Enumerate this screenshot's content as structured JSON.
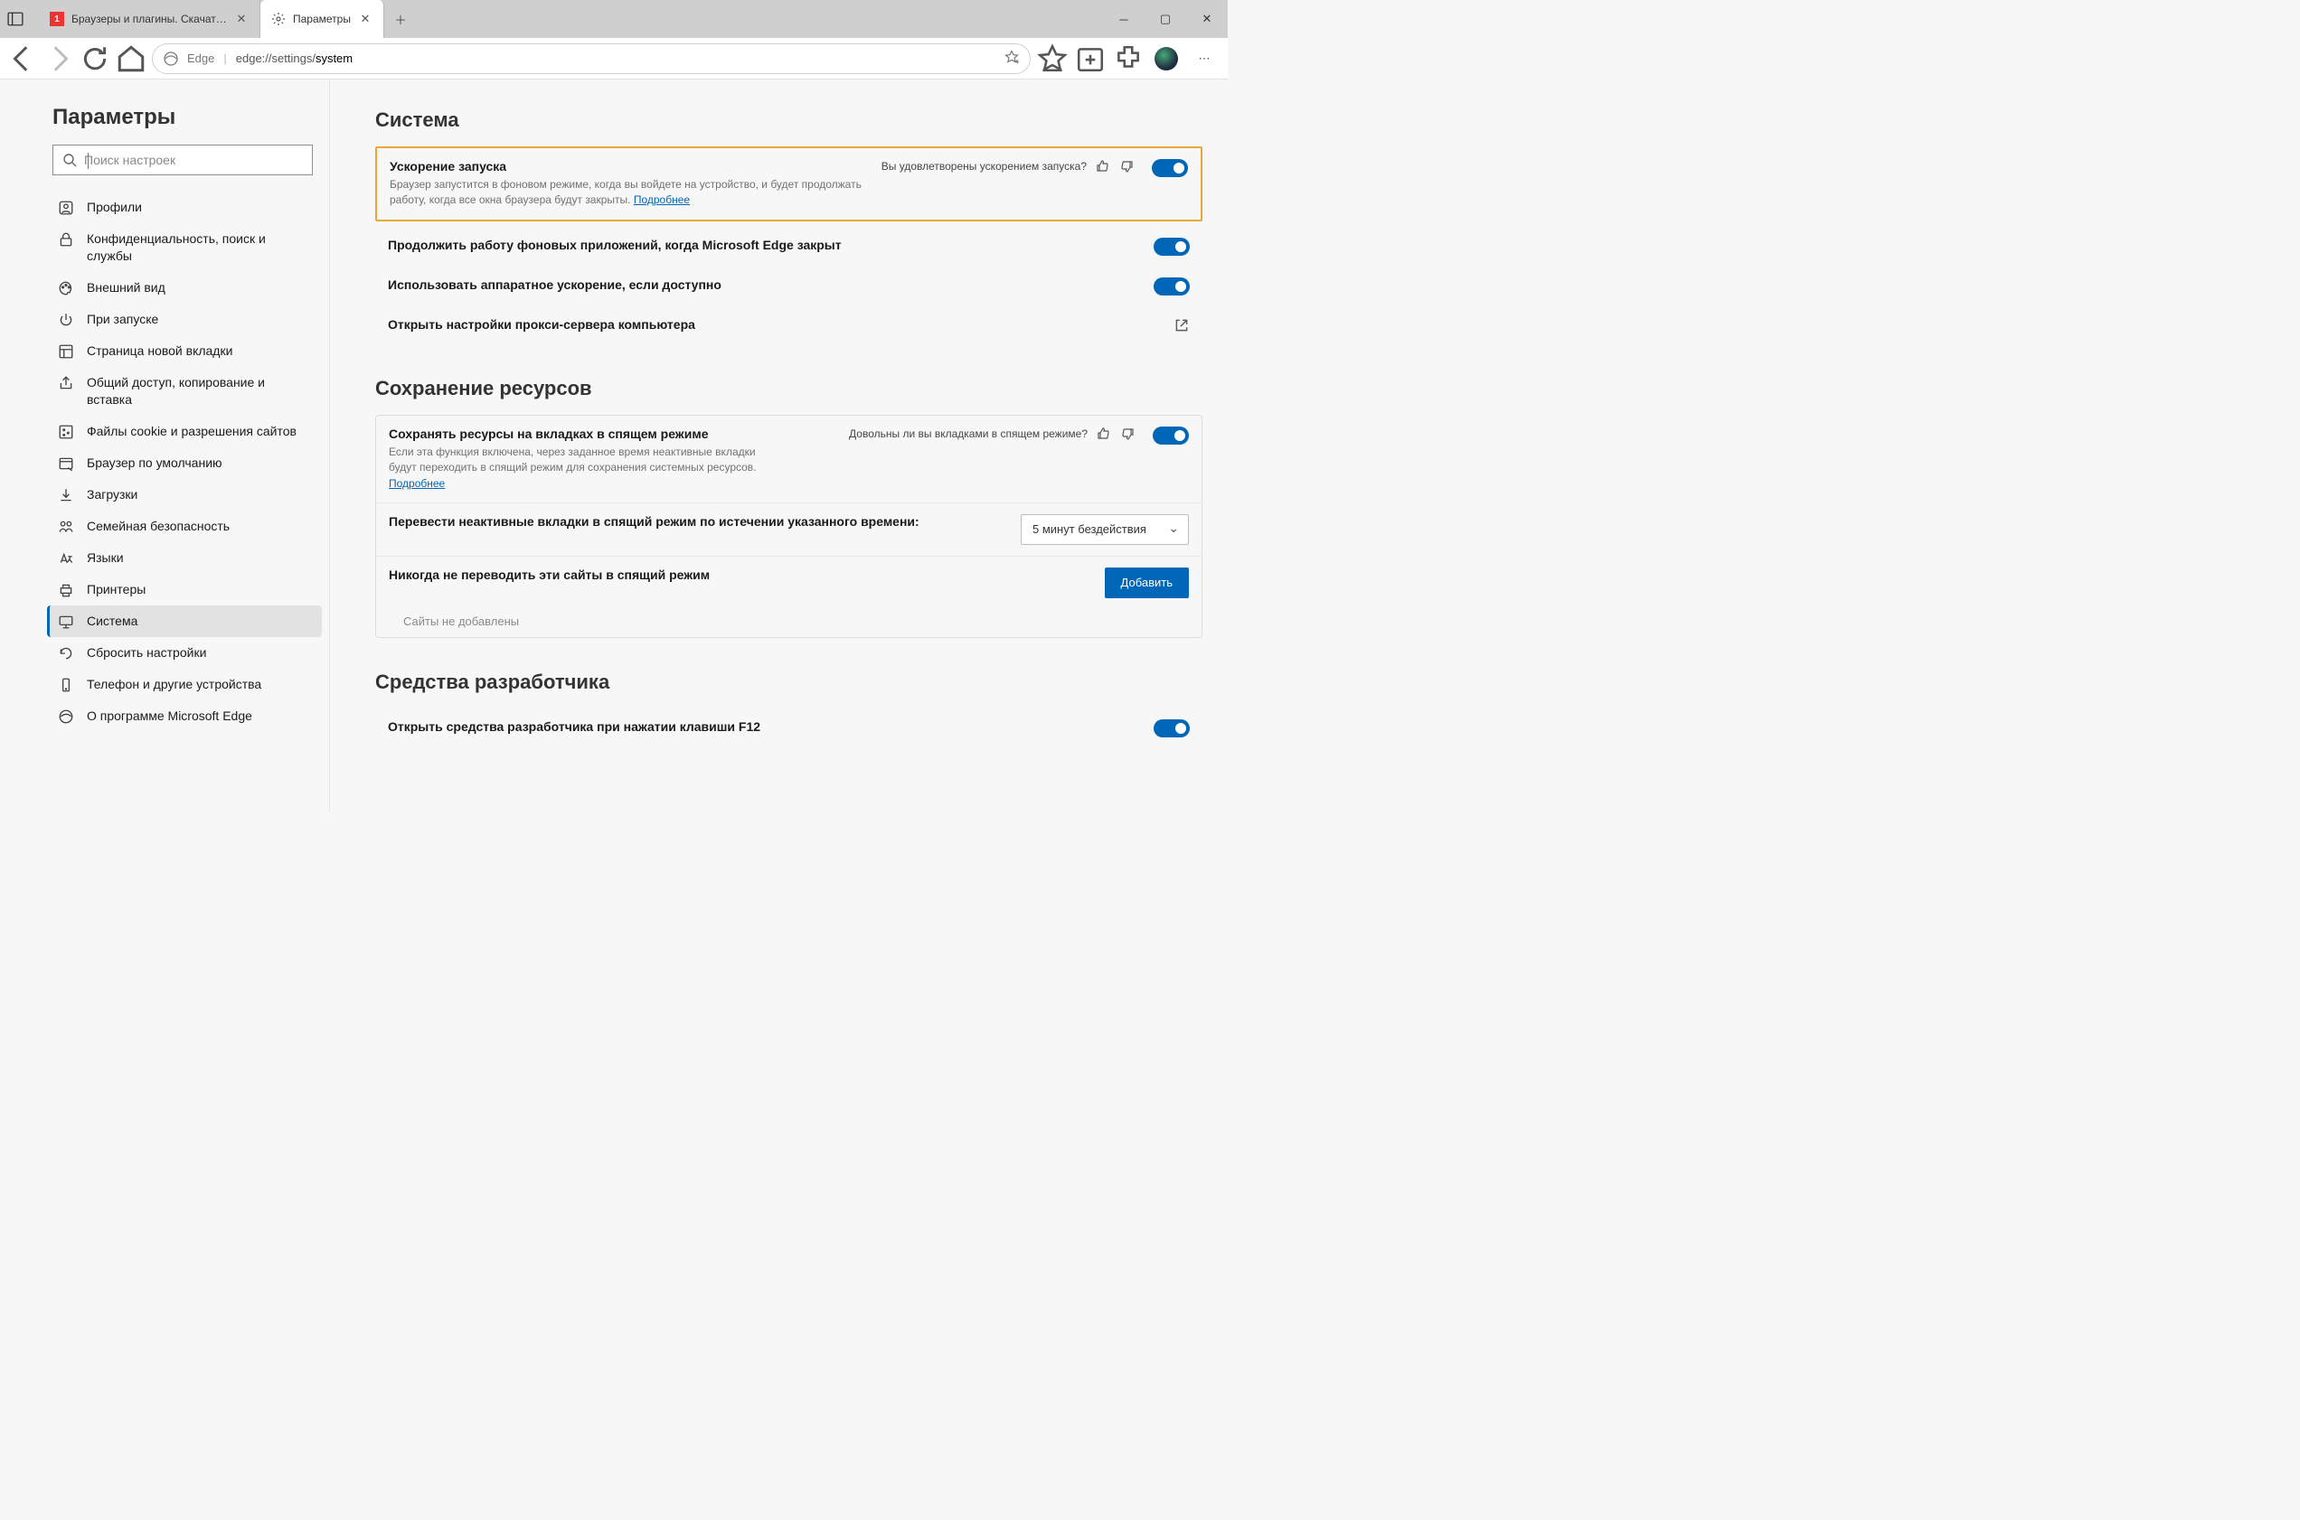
{
  "tabs": {
    "t0": {
      "title": "Браузеры и плагины. Скачать б"
    },
    "t1": {
      "title": "Параметры"
    }
  },
  "address": {
    "edge_label": "Edge",
    "url_prefix": "edge://settings/",
    "url_page": "system"
  },
  "sidebar": {
    "heading": "Параметры",
    "search_placeholder": "Поиск настроек",
    "items": {
      "profiles": "Профили",
      "privacy": "Конфиденциальность, поиск и службы",
      "appearance": "Внешний вид",
      "onstart": "При запуске",
      "newtab": "Страница новой вкладки",
      "share": "Общий доступ, копирование и вставка",
      "cookies": "Файлы cookie и разрешения сайтов",
      "default": "Браузер по умолчанию",
      "downloads": "Загрузки",
      "family": "Семейная безопасность",
      "languages": "Языки",
      "printers": "Принтеры",
      "system": "Система",
      "reset": "Сбросить настройки",
      "phone": "Телефон и другие устройства",
      "about": "О программе Microsoft Edge"
    }
  },
  "main": {
    "system_heading": "Система",
    "startup": {
      "title": "Ускорение запуска",
      "desc": "Браузер запустится в фоновом режиме, когда вы войдете на устройство, и будет продолжать работу, когда все окна браузера будут закрыты. ",
      "more": "Подробнее",
      "feedback": "Вы удовлетворены ускорением запуска?"
    },
    "bg_apps": "Продолжить работу фоновых приложений, когда Microsoft Edge закрыт",
    "hw_accel": "Использовать аппаратное ускорение, если доступно",
    "proxy": "Открыть настройки прокси-сервера компьютера",
    "resources_heading": "Сохранение ресурсов",
    "sleep": {
      "title": "Сохранять ресурсы на вкладках в спящем режиме",
      "desc": "Если эта функция включена, через заданное время неактивные вкладки будут переходить в спящий режим для сохранения системных ресурсов. ",
      "more": "Подробнее",
      "feedback": "Довольны ли вы вкладками в спящем режиме?"
    },
    "timeout_label": "Перевести неактивные вкладки в спящий режим по истечении указанного времени:",
    "timeout_value": "5 минут бездействия",
    "never_label": "Никогда не переводить эти сайты в спящий режим",
    "add_btn": "Добавить",
    "none_added": "Сайты не добавлены",
    "dev_heading": "Средства разработчика",
    "dev_f12": "Открыть средства разработчика при нажатии клавиши F12"
  }
}
